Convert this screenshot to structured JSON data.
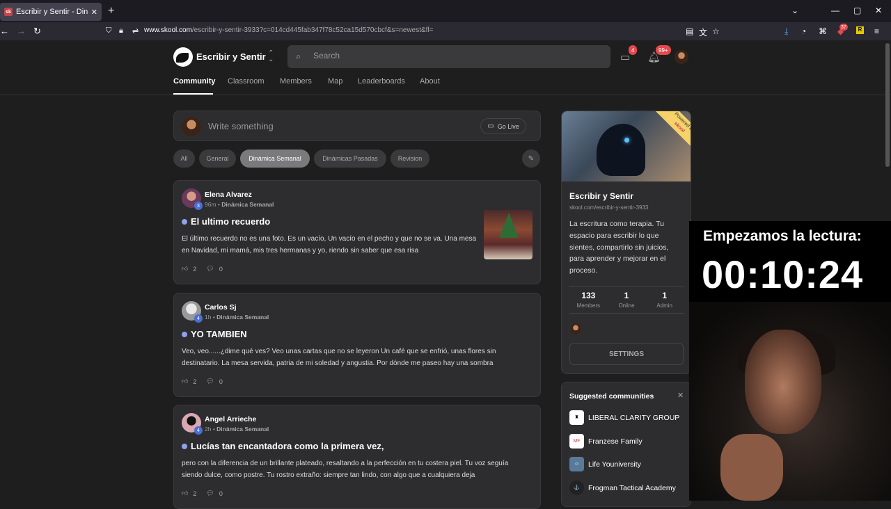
{
  "browser": {
    "tab_title": "Escribir y Sentir - Dinámica Sem",
    "tab_favicon": "sk",
    "url_domain": "www.skool.com",
    "url_path": "/escribir-y-sentir-3933?c=014cd445fab347f78c52ca15d570cbcf&s=newest&fl=",
    "ext_badge": "37"
  },
  "header": {
    "community_name": "Escribir y Sentir",
    "search_placeholder": "Search",
    "chat_badge": "4",
    "notif_badge": "99+"
  },
  "nav": {
    "tabs": [
      "Community",
      "Classroom",
      "Members",
      "Map",
      "Leaderboards",
      "About"
    ]
  },
  "composer": {
    "placeholder": "Write something",
    "golive": "Go Live"
  },
  "filters": [
    "All",
    "General",
    "Dinámica Semanal",
    "Dinámicas Pasadas",
    "Revision"
  ],
  "posts": [
    {
      "author": "Elena Alvarez",
      "level": "3",
      "time": "96m",
      "category": "Dinámica Semanal",
      "title": "El ultimo recuerdo",
      "body": "El último recuerdo no es una foto. Es un vacío, Un vacío en el pecho y que no se va. Una mesa en Navidad, mi mamá, mis tres hermanas y yo, riendo sin saber que esa risa",
      "likes": "2",
      "comments": "0"
    },
    {
      "author": "Carlos Sj",
      "level": "4",
      "time": "1h",
      "category": "Dinámica Semanal",
      "title": "YO TAMBIEN",
      "body": "Veo, veo......¿dime qué ves? Veo unas cartas que no se leyeron Un café que se enfrió, unas flores sin destinatario. La mesa servida, patria de mi soledad y angustia. Por dónde me paseo hay una sombra",
      "likes": "2",
      "comments": "0"
    },
    {
      "author": "Angel Arrieche",
      "level": "4",
      "time": "2h",
      "category": "Dinámica Semanal",
      "title": "Lucías tan encantadora como la primera vez,",
      "body": "pero con la diferencia de un brillante plateado, resaltando a la perfección en tu costera piel. Tu voz seguía siendo dulce, como postre. Tu rostro extraño: siempre tan lindo, con algo que a cualquiera deja",
      "likes": "2",
      "comments": "0"
    }
  ],
  "sidebar": {
    "ribbon": "Powered by",
    "ribbon_brand": "skool",
    "name": "Escribir y Sentir",
    "url": "skool.com/escribir-y-sentir-3933",
    "description": "La escritura como terapia. Tu espacio para escribir lo que sientes, compartirlo sin juicios, para aprender y mejorar en el proceso.",
    "stats": [
      {
        "value": "133",
        "label": "Members"
      },
      {
        "value": "1",
        "label": "Online"
      },
      {
        "value": "1",
        "label": "Admin"
      }
    ],
    "settings": "SETTINGS"
  },
  "suggested": {
    "heading": "Suggested communities",
    "items": [
      "LIBERAL CLARITY GROUP",
      "Franzese Family",
      "Life Youniversity",
      "Frogman Tactical Academy"
    ]
  },
  "overlay": {
    "heading": "Empezamos la lectura:",
    "timer": "00:10:24"
  }
}
